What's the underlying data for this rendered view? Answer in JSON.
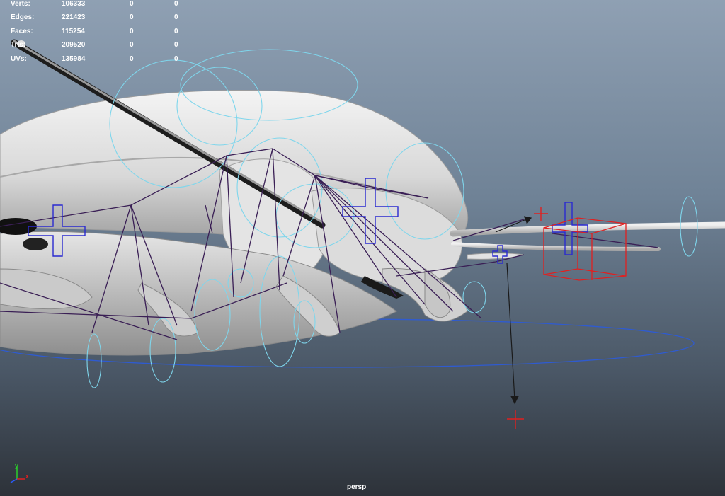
{
  "hud": {
    "rows": [
      {
        "label": "Verts:",
        "v1": "106333",
        "v2": "0",
        "v3": "0"
      },
      {
        "label": "Edges:",
        "v1": "221423",
        "v2": "0",
        "v3": "0"
      },
      {
        "label": "Faces:",
        "v1": "115254",
        "v2": "0",
        "v3": "0"
      },
      {
        "label": "Tris:",
        "v1": "209520",
        "v2": "0",
        "v3": "0"
      },
      {
        "label": "UVs:",
        "v1": "135984",
        "v2": "0",
        "v3": "0"
      }
    ]
  },
  "viewport": {
    "camera_label": "persp"
  },
  "axis_gizmo": {
    "y_label": "y",
    "x_label": "x",
    "y_color": "#2bd12b",
    "x_color": "#e02020"
  },
  "colors": {
    "control_curve": "#7fd6ec",
    "joint_line": "#3a1f55",
    "locator": "#2a2ad0",
    "selected": "#e02020"
  }
}
